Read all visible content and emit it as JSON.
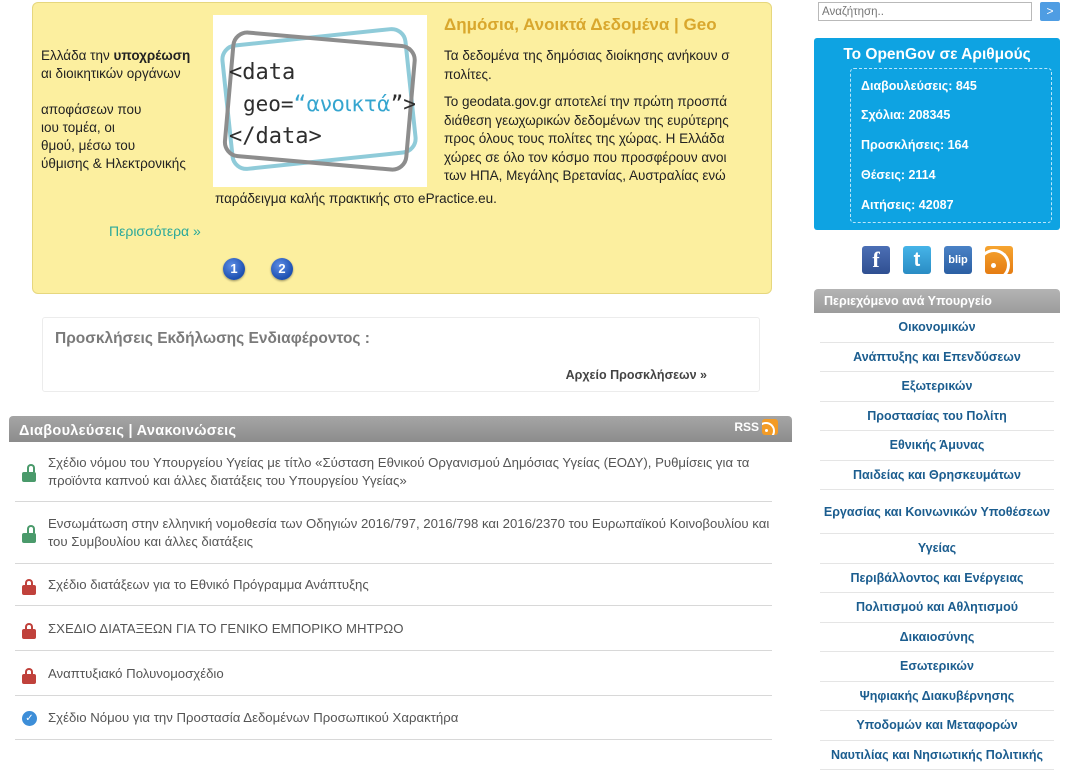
{
  "featured": {
    "left_text": [
      {
        "pre": "Ελλάδα την ",
        "bold": "υποχρέωση",
        "post": ""
      },
      {
        "pre": "αι διοικητικών οργάνων",
        "bold": "",
        "post": ""
      },
      {
        "gap": true
      },
      {
        "pre": "αποφάσεων που",
        "bold": "",
        "post": ""
      },
      {
        "pre": "ιου τομέα, οι",
        "bold": "",
        "post": ""
      },
      {
        "pre": "θμού, μέσω του",
        "bold": "",
        "post": ""
      },
      {
        "pre": "ύθμισης & Ηλεκτρονικής",
        "bold": "",
        "post": ""
      }
    ],
    "image": {
      "line1": "<data",
      "line2_pre": "geo=",
      "line2_quote_open": "“",
      "line2_word": "ανοικτά",
      "line2_quote_close": "”>",
      "line3": "</data>"
    },
    "title": "Δημόσια, Ανοικτά Δεδομένα | Geo",
    "body_lines": [
      "Τα δεδομένα της δημόσιας διοίκησης ανήκουν σ",
      "πολίτες.",
      "",
      "Το geodata.gov.gr αποτελεί την πρώτη προσπά",
      "διάθεση γεωχωρικών δεδομένων της ευρύτερης",
      "προς όλους τους πολίτες της χώρας. Η Ελλάδα",
      "χώρες σε όλο τον κόσμο που προσφέρουν ανοι",
      "των ΗΠΑ, Μεγάλης Βρετανίας, Αυστραλίας ενώ"
    ],
    "last_line": "παράδειγμα καλής πρακτικής στο ePractice.eu.",
    "more": "Περισσότερα »",
    "pages": [
      "1",
      "2"
    ]
  },
  "calls": {
    "title": "Προσκλήσεις Εκδήλωσης Ενδιαφέροντος :",
    "archive": "Αρχείο Προσκλήσεων »"
  },
  "consultations": {
    "title": "Διαβουλεύσεις | Ανακοινώσεις",
    "rss": "RSS",
    "items": [
      {
        "text": "Σχέδιο νόμου του Υπουργείου Υγείας με τίτλο «Σύσταση Εθνικού Οργανισμού Δημόσιας Υγείας (ΕΟΔΥ), Ρυθμίσεις για τα προϊόντα καπνού και άλλες διατάξεις του Υπουργείου Υγείας»",
        "status": "open"
      },
      {
        "text": "Ενσωμάτωση στην ελληνική νομοθεσία των Οδηγιών 2016/797, 2016/798 και 2016/2370 του Ευρωπαϊκού Κοινοβουλίου και του Συμβουλίου και άλλες διατάξεις",
        "status": "open"
      },
      {
        "text": "Σχέδιο διατάξεων για το Εθνικό Πρόγραμμα Ανάπτυξης",
        "status": "closed"
      },
      {
        "text": "ΣΧΕΔΙΟ ΔΙΑΤΑΞΕΩΝ ΓΙΑ ΤΟ ΓΕΝΙΚΟ ΕΜΠΟΡΙΚΟ ΜΗΤΡΩΟ",
        "status": "closed"
      },
      {
        "text": "Αναπτυξιακό Πολυνομοσχέδιο",
        "status": "closed"
      },
      {
        "text": "Σχέδιο Νόμου για την Προστασία Δεδομένων Προσωπικού Χαρακτήρα",
        "status": "completed"
      }
    ]
  },
  "search": {
    "placeholder": "Αναζήτηση..",
    "button": ">"
  },
  "stats": {
    "title": "Το OpenGov σε Αριθμούς",
    "items": [
      "Διαβουλεύσεις: 845",
      "Σχόλια: 208345",
      "Προσκλήσεις: 164",
      "Θέσεις: 2114",
      "Αιτήσεις: 42087"
    ]
  },
  "social": {
    "facebook": "f",
    "twitter": "t",
    "blip": "blip"
  },
  "ministries": {
    "title": "Περιεχόμενο ανά Υπουργείο",
    "items": [
      "Οικονομικών",
      "Ανάπτυξης και Επενδύσεων",
      "Εξωτερικών",
      "Προστασίας του Πολίτη",
      "Εθνικής Άμυνας",
      "Παιδείας και Θρησκευμάτων",
      "Εργασίας και Κοινωνικών Υποθέσεων",
      "Υγείας",
      "Περιβάλλοντος και Ενέργειας",
      "Πολιτισμού και Αθλητισμού",
      "Δικαιοσύνης",
      "Εσωτερικών",
      "Ψηφιακής Διακυβέρνησης",
      "Υποδομών και Μεταφορών",
      "Ναυτιλίας και Νησιωτικής Πολιτικής"
    ]
  },
  "colors": {
    "accent_blue": "#0ea3e2",
    "slider_bg": "#fcef9f",
    "title_gold": "#d9a72d",
    "link_teal": "#2aa89a",
    "ministry_link": "#1b5d8f",
    "lock_green": "#4a9a6b",
    "lock_red": "#c0413b"
  }
}
